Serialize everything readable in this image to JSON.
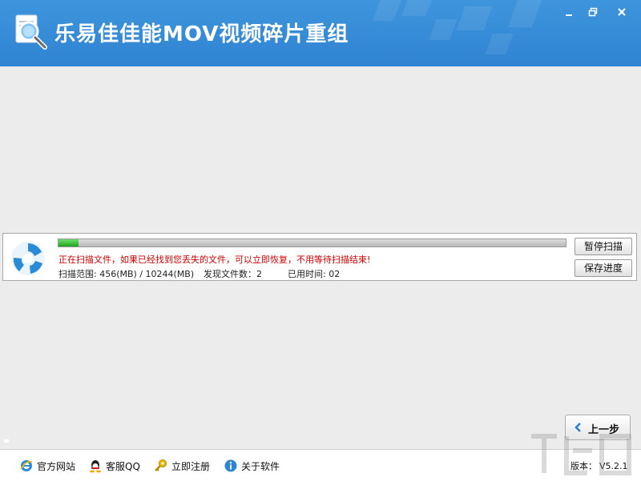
{
  "app": {
    "title": "乐易佳佳能MOV视频碎片重组",
    "accent_color": "#3a8fd9"
  },
  "window_controls": {
    "minimize_icon": "minimize-icon",
    "restore_icon": "restore-icon",
    "close_icon": "close-icon"
  },
  "scan": {
    "progress_fraction": 0.04,
    "message": "正在扫描文件，如果已经找到您丢失的文件，可以立即恢复，不用等待扫描结束!",
    "range_label": "扫描范围:",
    "range_value": "456(MB) / 10244(MB)",
    "found_label": "发现文件数：",
    "found_value": "2",
    "time_label": "已用时间:",
    "time_value": "02",
    "pause_button": "暂停扫描",
    "save_button": "保存进度",
    "message_color": "#d00000"
  },
  "nav": {
    "back_button": "上一步"
  },
  "footer": {
    "links": [
      {
        "label": "官方网站",
        "icon": "ie-icon"
      },
      {
        "label": "客服QQ",
        "icon": "qq-icon"
      },
      {
        "label": "立即注册",
        "icon": "key-icon"
      },
      {
        "label": "关于软件",
        "icon": "info-icon"
      }
    ],
    "version_label": "版本：",
    "version_value": "V5.2.1"
  }
}
